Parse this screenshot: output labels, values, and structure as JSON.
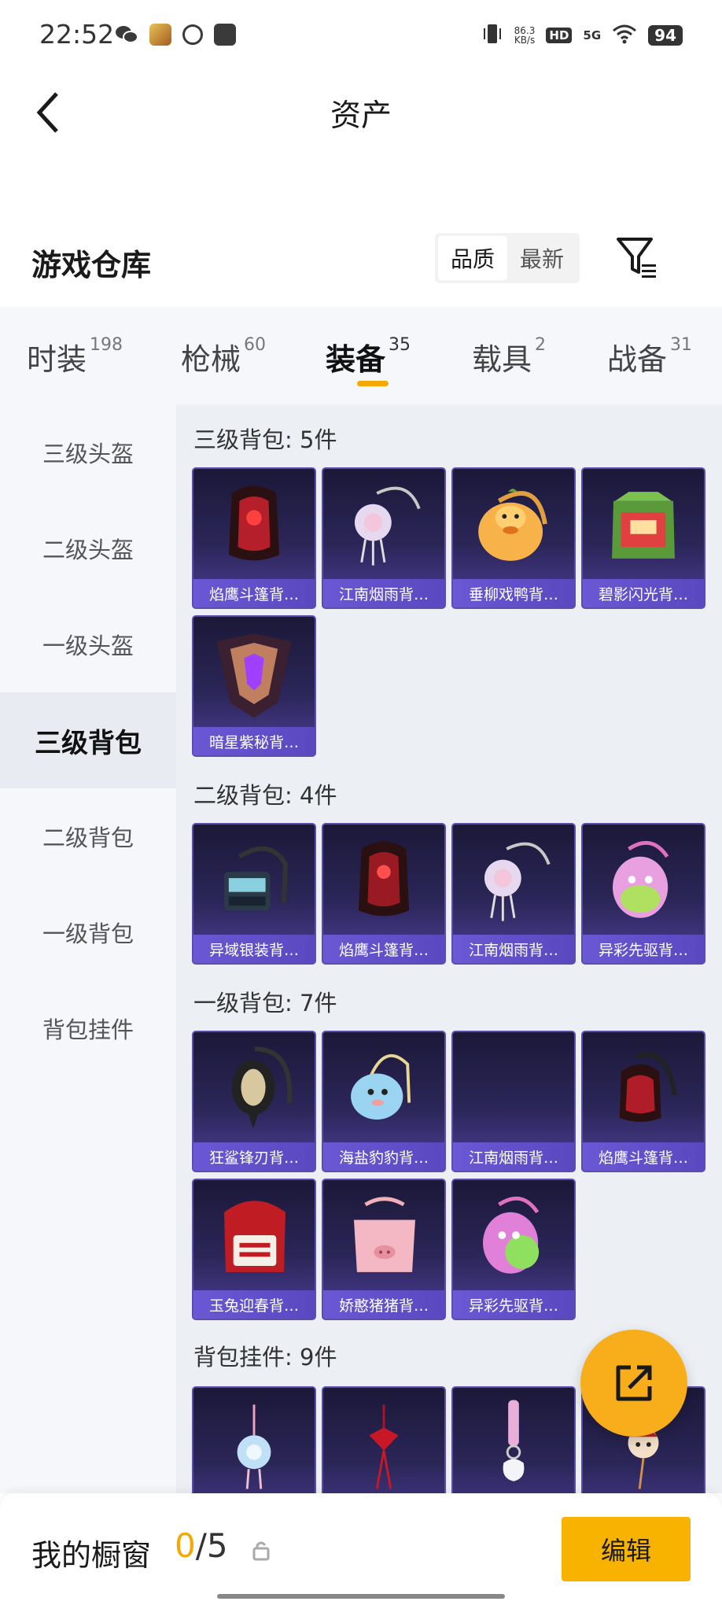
{
  "status_bar": {
    "time": "22:52",
    "net_speed_value": "86.3",
    "net_speed_unit": "KB/s",
    "hd": "HD",
    "signal": "5G",
    "battery": "94"
  },
  "header": {
    "title": "资产"
  },
  "warehouse": {
    "title": "游戏仓库",
    "sort_options": [
      "品质",
      "最新"
    ],
    "sort_active": "品质"
  },
  "tabs": [
    {
      "label": "时装",
      "count": "198"
    },
    {
      "label": "枪械",
      "count": "60"
    },
    {
      "label": "装备",
      "count": "35"
    },
    {
      "label": "载具",
      "count": "2"
    },
    {
      "label": "战备",
      "count": "31"
    }
  ],
  "active_tab": "装备",
  "subnav": [
    {
      "label": "三级头盔"
    },
    {
      "label": "二级头盔"
    },
    {
      "label": "一级头盔"
    },
    {
      "label": "三级背包"
    },
    {
      "label": "二级背包"
    },
    {
      "label": "一级背包"
    },
    {
      "label": "背包挂件"
    }
  ],
  "active_subnav": "三级背包",
  "sections": [
    {
      "title": "三级背包: 5件",
      "items": [
        "焰鹰斗篷背…",
        "江南烟雨背…",
        "垂柳戏鸭背…",
        "碧影闪光背…",
        "暗星紫秘背…"
      ]
    },
    {
      "title": "二级背包: 4件",
      "items": [
        "异域银装背…",
        "焰鹰斗篷背…",
        "江南烟雨背…",
        "异彩先驱背…"
      ]
    },
    {
      "title": "一级背包: 7件",
      "items": [
        "狂鲨锋刃背…",
        "海盐豹豹背…",
        "江南烟雨背…",
        "焰鹰斗篷背…",
        "玉兔迎春背…",
        "娇憨猪猪背…",
        "异彩先驱背…"
      ]
    },
    {
      "title": "背包挂件: 9件",
      "items": [
        "",
        "",
        "",
        ""
      ]
    }
  ],
  "bottom_bar": {
    "label": "我的橱窗",
    "current": "0",
    "total": "/5",
    "edit_label": "编辑"
  },
  "colors": {
    "accent": "#f7b300",
    "item_bg": "#2b2658",
    "item_label_bg": "#6a58d4"
  }
}
